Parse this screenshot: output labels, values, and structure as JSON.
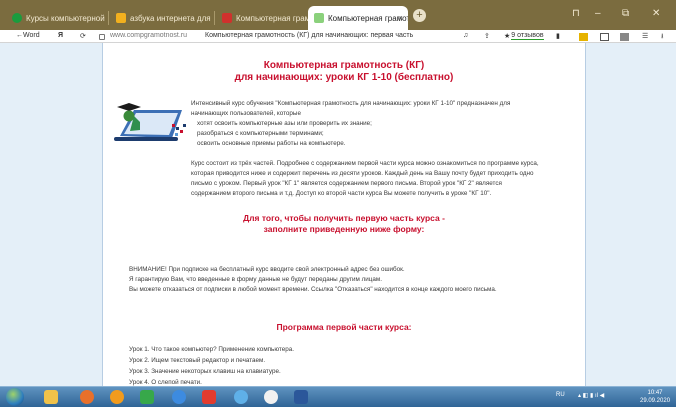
{
  "tabs": [
    {
      "label": "Курсы компьютерной гра",
      "favicon_color": "#1a9c3e",
      "active": false
    },
    {
      "label": "азбука интернета для пен",
      "favicon_color": "#f2b01e",
      "active": false
    },
    {
      "label": "Компьютерная грамотнос",
      "favicon_color": "#d0312d",
      "active": false
    },
    {
      "label": "Компьютерная грамотно",
      "favicon_color": "#8bd17c",
      "active": true
    }
  ],
  "tab_close_glyph": "×",
  "new_tab_glyph": "+",
  "window_controls": [
    "‒",
    "⧉",
    "✕"
  ],
  "address_bar": {
    "back_label": "←Word",
    "yandex_glyph": "Я",
    "host": "www.compgramotnost.ru",
    "page_title": "Компьютерная грамотность (КГ) для начинающих: первая часть",
    "reviews_star": "★",
    "reviews_text": "9 отзывов"
  },
  "page": {
    "title_line1": "Компьютерная грамотность (КГ)",
    "title_line2": "для начинающих: уроки КГ 1-10 (бесплатно)",
    "intro_line1": "Интенсивный курс обучения \"Компьютерная грамотность для начинающих: уроки КГ 1-10\" предназначен для",
    "intro_line2": "начинающих пользователей, которые",
    "bullets": [
      "хотят освоить компьютерные азы или проверить их знание;",
      "разобраться с компьютерными терминами;",
      "освоить основные приемы работы на компьютере."
    ],
    "desc_lines": [
      "Курс состоит из трёх частей. Подробнее с содержанием первой части курса можно ознакомиться по программе курса,",
      "которая приводится ниже и содержит перечень из десяти уроков. Каждый день на Вашу почту будет приходить одно",
      "письмо с уроком. Первый урок \"КГ 1\" является содержанием первого письма. Второй урок \"КГ 2\" является",
      "содержанием второго письма и т.д. Доступ ко второй части курса Вы можете получить в уроке \"КГ 10\"."
    ],
    "form_heading_line1": "Для того, чтобы получить первую часть курса -",
    "form_heading_line2": "заполните приведенную ниже форму:",
    "warning_lines": [
      "ВНИМАНИЕ! При подписке на бесплатный курс вводите свой электронный адрес без ошибок.",
      "Я гарантирую Вам, что введенные в форму данные не будут переданы другим лицам.",
      "Вы можете отказаться от подписки в любой момент времени. Ссылка \"Отказаться\" находится в конце каждого моего письма."
    ],
    "program_heading": "Программа первой части курса:",
    "lessons": [
      "Урок 1. Что такое компьютер? Применение компьютера.",
      "Урок 2. Ищем текстовый редактор и печатаем.",
      "Урок 3. Значение некоторых клавиш на клавиатуре.",
      "Урок 4. О слепой печати."
    ]
  },
  "taskbar": {
    "apps": [
      {
        "name": "explorer",
        "color": "#f0c24a"
      },
      {
        "name": "media-player",
        "color": "#e8702a"
      },
      {
        "name": "avast",
        "color": "#f29b1d"
      },
      {
        "name": "network-app",
        "color": "#37a84a"
      },
      {
        "name": "chrome",
        "color": "#3d8be0"
      },
      {
        "name": "yandex",
        "color": "#e23b2e"
      },
      {
        "name": "globe",
        "color": "#5fb0e8"
      },
      {
        "name": "yandex-browser",
        "color": "#f1f1f1"
      },
      {
        "name": "word",
        "color": "#2b579a"
      }
    ],
    "language": "RU",
    "time": "10:47",
    "date": "29.09.2020"
  }
}
